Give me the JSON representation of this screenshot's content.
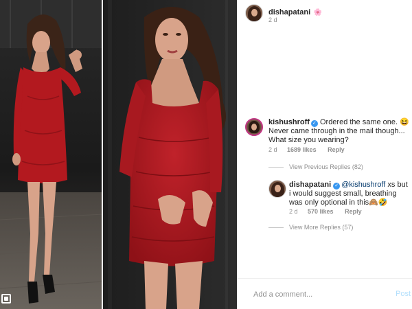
{
  "post": {
    "author": "dishapatani",
    "author_emoji": "🌸",
    "time": "2 d"
  },
  "comments": [
    {
      "username": "kishushroff",
      "verified": "✓",
      "text": "Ordered the same one. 😆 Never came through in the mail though... What size you wearing?",
      "time": "2 d",
      "likes": "1689 likes",
      "reply_label": "Reply",
      "view_replies": "View Previous Replies (82)"
    },
    {
      "username": "dishapatani",
      "verified": "✓",
      "mention": "@kishushroff",
      "text": "xs but i would suggest small, breathing was only optional in this🙈🤣",
      "time": "2 d",
      "likes": "570 likes",
      "reply_label": "Reply",
      "view_replies": "View More Replies (57)"
    }
  ],
  "add_comment": {
    "placeholder": "Add a comment...",
    "post_label": "Post"
  },
  "colors": {
    "dress": "#b3191f",
    "link_blue": "#3897f0",
    "post_disabled": "#b2dffc"
  },
  "icons": {
    "multi_image": "multiple-posts-icon",
    "verified": "verified-badge-icon"
  }
}
